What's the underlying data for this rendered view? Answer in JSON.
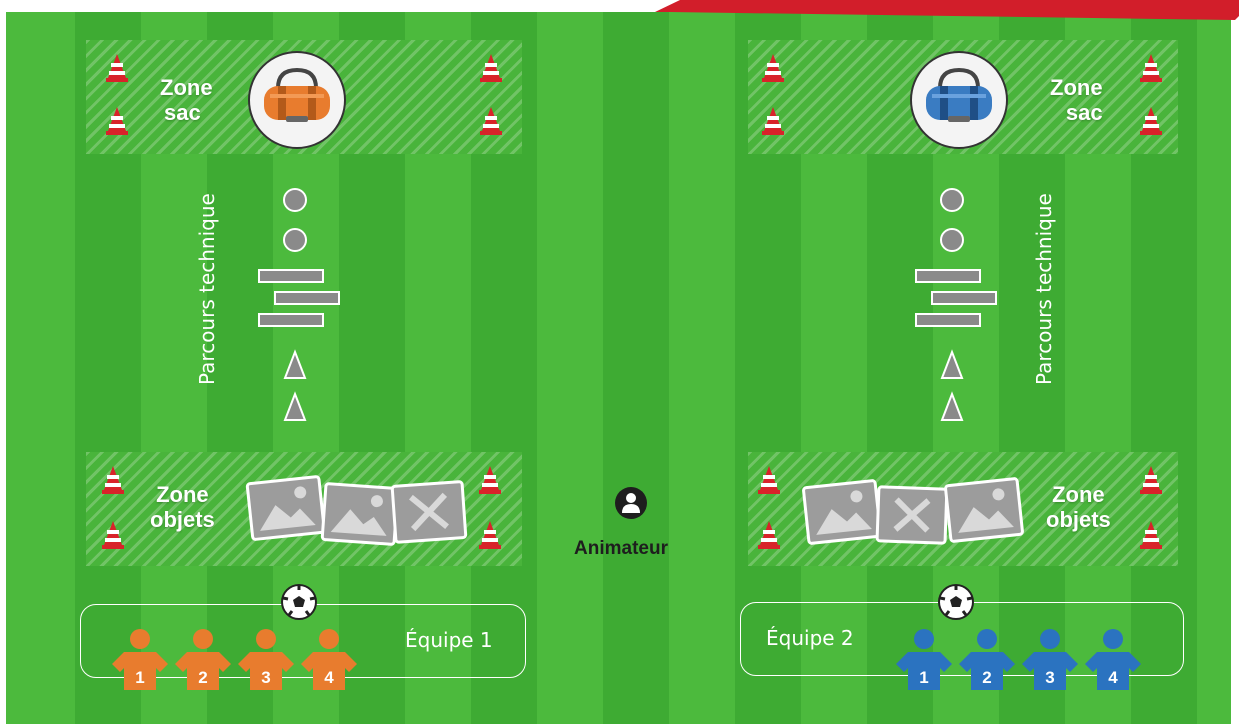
{
  "left_half": {
    "zone_sac": {
      "line1": "Zone",
      "line2": "sac"
    },
    "bag_color": "#e87c2e",
    "course_label": "Parcours technique",
    "zone_objets": {
      "line1": "Zone",
      "line2": "objets"
    },
    "team": {
      "label": "Équipe 1",
      "color": "#e87c2e",
      "players": [
        "1",
        "2",
        "3",
        "4"
      ]
    }
  },
  "right_half": {
    "zone_sac": {
      "line1": "Zone",
      "line2": "sac"
    },
    "bag_color": "#3a7cc2",
    "course_label": "Parcours technique",
    "zone_objets": {
      "line1": "Zone",
      "line2": "objets"
    },
    "team": {
      "label": "Équipe 2",
      "color": "#2b73c0",
      "players": [
        "1",
        "2",
        "3",
        "4"
      ]
    }
  },
  "animateur": {
    "label": "Animateur",
    "icon": "person-icon"
  },
  "colors": {
    "grass_light": "#4fbd3f",
    "grass_dark": "#3fae34",
    "cone": "#d8232a",
    "accent": "#d21e2a"
  }
}
